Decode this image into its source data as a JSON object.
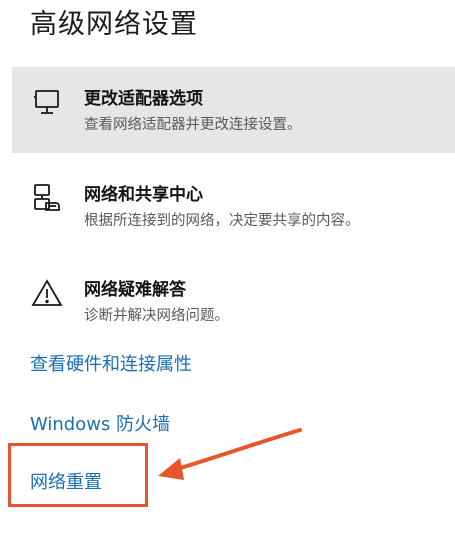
{
  "page": {
    "title": "高级网络设置"
  },
  "options": [
    {
      "title": "更改适配器选项",
      "description": "查看网络适配器并更改连接设置。",
      "icon": "monitor-icon"
    },
    {
      "title": "网络和共享中心",
      "description": "根据所连接到的网络，决定要共享的内容。",
      "icon": "network-share-icon"
    },
    {
      "title": "网络疑难解答",
      "description": "诊断并解决网络问题。",
      "icon": "warning-icon"
    }
  ],
  "links": {
    "hardware": "查看硬件和连接属性",
    "firewall": "Windows 防火墙",
    "reset": "网络重置"
  },
  "colors": {
    "link": "#1a6fb8",
    "highlight_bg": "#e6e6e6",
    "annotation": "#e8552c"
  }
}
